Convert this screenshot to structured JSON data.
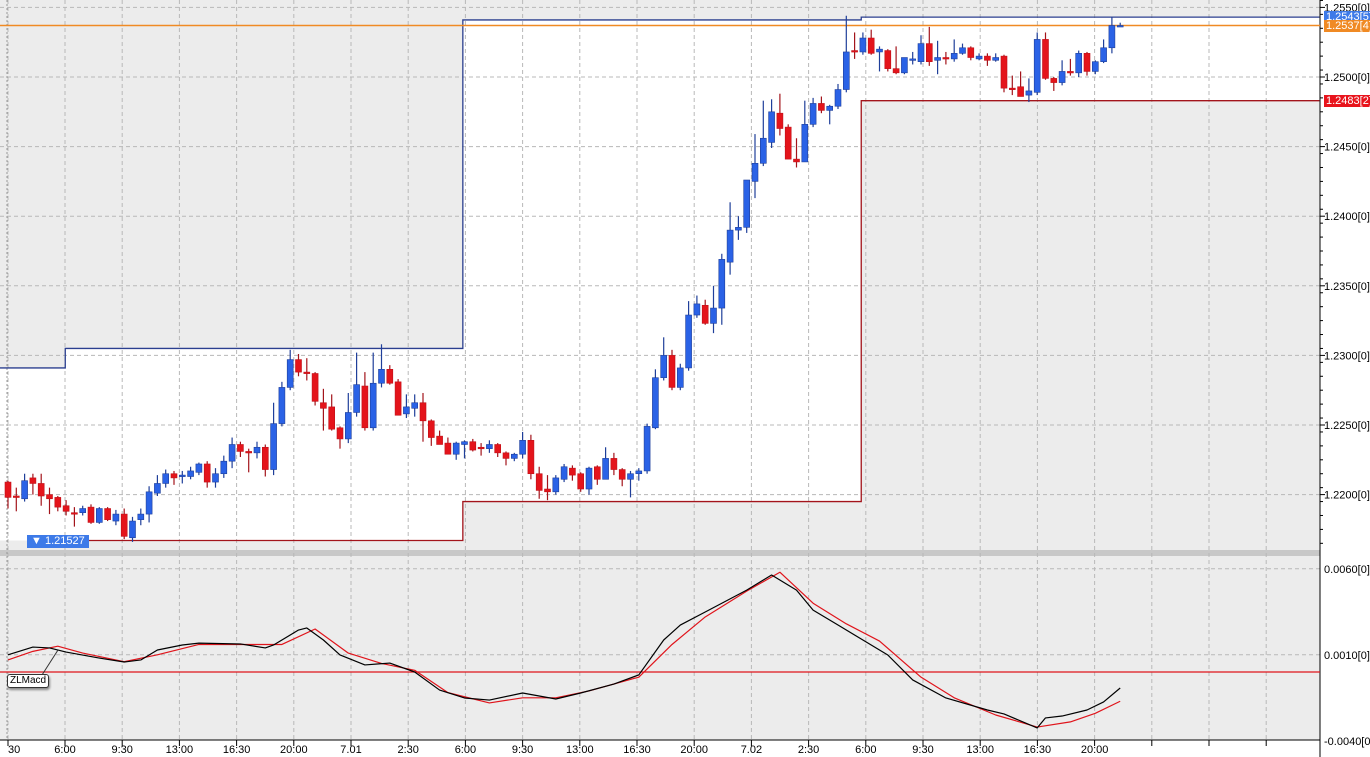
{
  "chart_data": {
    "type": "candlestick",
    "interval": "30min",
    "price_axis": {
      "range": [
        1.2165,
        1.2555
      ],
      "ticks": [
        "1.2550[0]",
        "1.2500[0]",
        "1.2450[0]",
        "1.2400[0]",
        "1.2350[0]",
        "1.2300[0]",
        "1.2250[0]",
        "1.2200[0]"
      ],
      "tick_values": [
        1.255,
        1.25,
        1.245,
        1.24,
        1.235,
        1.23,
        1.225,
        1.22
      ]
    },
    "time_ticks": [
      "30",
      "6:00",
      "9:30",
      "13:00",
      "16:30",
      "20:00",
      "7.01",
      "2:30",
      "6:00",
      "9:30",
      "13:00",
      "16:30",
      "20:00",
      "7.02",
      "2:30",
      "6:00",
      "9:30",
      "13:00",
      "16:30",
      "20:00"
    ],
    "colors": {
      "up": "#2a62e6",
      "down": "#e4141b",
      "upper_channel": "#2b3f8f",
      "lower_channel": "#a3141b",
      "last_price": "#f08a24",
      "macd": "#000000",
      "signal": "#e0141b",
      "shade": "#ececec"
    },
    "candles": [
      [
        1.2209,
        1.221,
        1.219,
        1.2198
      ],
      [
        1.2199,
        1.2205,
        1.2188,
        1.2198
      ],
      [
        1.2197,
        1.2215,
        1.2195,
        1.221
      ],
      [
        1.2212,
        1.2215,
        1.22,
        1.2208
      ],
      [
        1.2208,
        1.2215,
        1.2192,
        1.2199
      ],
      [
        1.22,
        1.2205,
        1.2186,
        1.2197
      ],
      [
        1.2198,
        1.2199,
        1.2188,
        1.2191
      ],
      [
        1.2192,
        1.2196,
        1.2185,
        1.2188
      ],
      [
        1.2187,
        1.2191,
        1.2177,
        1.2186
      ],
      [
        1.2187,
        1.2192,
        1.2185,
        1.219
      ],
      [
        1.2191,
        1.2193,
        1.2179,
        1.218
      ],
      [
        1.218,
        1.2191,
        1.2179,
        1.219
      ],
      [
        1.219,
        1.2191,
        1.2181,
        1.2182
      ],
      [
        1.2181,
        1.2189,
        1.2178,
        1.2186
      ],
      [
        1.2186,
        1.219,
        1.2168,
        1.217
      ],
      [
        1.2169,
        1.2184,
        1.2166,
        1.2181
      ],
      [
        1.2182,
        1.219,
        1.2178,
        1.2186
      ],
      [
        1.2186,
        1.2206,
        1.218,
        1.2202
      ],
      [
        1.2201,
        1.2214,
        1.2199,
        1.2208
      ],
      [
        1.2208,
        1.2218,
        1.2205,
        1.2215
      ],
      [
        1.2215,
        1.2217,
        1.2207,
        1.2212
      ],
      [
        1.2213,
        1.2217,
        1.2208,
        1.2214
      ],
      [
        1.2213,
        1.222,
        1.2211,
        1.2217
      ],
      [
        1.2216,
        1.2223,
        1.2214,
        1.2222
      ],
      [
        1.2222,
        1.2224,
        1.2205,
        1.2209
      ],
      [
        1.2209,
        1.2219,
        1.2205,
        1.2215
      ],
      [
        1.2215,
        1.2228,
        1.2212,
        1.2224
      ],
      [
        1.2224,
        1.2241,
        1.2219,
        1.2236
      ],
      [
        1.2236,
        1.2238,
        1.2227,
        1.2231
      ],
      [
        1.2231,
        1.2233,
        1.2216,
        1.223
      ],
      [
        1.223,
        1.2238,
        1.2226,
        1.2234
      ],
      [
        1.2234,
        1.2236,
        1.2213,
        1.2218
      ],
      [
        1.2218,
        1.2266,
        1.2214,
        1.2251
      ],
      [
        1.2251,
        1.2281,
        1.2249,
        1.2277
      ],
      [
        1.2277,
        1.2304,
        1.2275,
        1.2297
      ],
      [
        1.2297,
        1.2301,
        1.2285,
        1.2288
      ],
      [
        1.2288,
        1.2298,
        1.2282,
        1.2287
      ],
      [
        1.2287,
        1.2288,
        1.2264,
        1.2267
      ],
      [
        1.2266,
        1.2276,
        1.2246,
        1.2262
      ],
      [
        1.2263,
        1.2272,
        1.2246,
        1.2247
      ],
      [
        1.2248,
        1.2249,
        1.2233,
        1.224
      ],
      [
        1.224,
        1.2273,
        1.2237,
        1.2259
      ],
      [
        1.2259,
        1.2302,
        1.2256,
        1.2279
      ],
      [
        1.2278,
        1.2288,
        1.2246,
        1.2248
      ],
      [
        1.2248,
        1.2302,
        1.2246,
        1.228
      ],
      [
        1.228,
        1.2308,
        1.2277,
        1.229
      ],
      [
        1.229,
        1.2293,
        1.2279,
        1.228
      ],
      [
        1.2281,
        1.2283,
        1.2257,
        1.2257
      ],
      [
        1.2258,
        1.2272,
        1.2255,
        1.2263
      ],
      [
        1.2262,
        1.2272,
        1.2256,
        1.2266
      ],
      [
        1.2266,
        1.2273,
        1.2238,
        1.2253
      ],
      [
        1.2253,
        1.2254,
        1.2235,
        1.2241
      ],
      [
        1.2242,
        1.2246,
        1.2236,
        1.2236
      ],
      [
        1.2237,
        1.2241,
        1.2229,
        1.2229
      ],
      [
        1.2229,
        1.2238,
        1.2225,
        1.2237
      ],
      [
        1.2236,
        1.2239,
        1.2226,
        1.2238
      ],
      [
        1.2238,
        1.224,
        1.2231,
        1.2232
      ],
      [
        1.2234,
        1.2237,
        1.2228,
        1.2233
      ],
      [
        1.2233,
        1.2239,
        1.223,
        1.2236
      ],
      [
        1.2236,
        1.2237,
        1.2227,
        1.223
      ],
      [
        1.223,
        1.2231,
        1.2221,
        1.2226
      ],
      [
        1.2226,
        1.223,
        1.2224,
        1.2229
      ],
      [
        1.2229,
        1.2245,
        1.2226,
        1.2239
      ],
      [
        1.2239,
        1.2243,
        1.2211,
        1.2215
      ],
      [
        1.2215,
        1.222,
        1.2197,
        1.2203
      ],
      [
        1.2204,
        1.2214,
        1.2196,
        1.2202
      ],
      [
        1.2202,
        1.2214,
        1.22,
        1.2212
      ],
      [
        1.2211,
        1.2222,
        1.2209,
        1.222
      ],
      [
        1.2219,
        1.2221,
        1.221,
        1.2214
      ],
      [
        1.2215,
        1.2216,
        1.2202,
        1.2204
      ],
      [
        1.2204,
        1.222,
        1.22,
        1.2219
      ],
      [
        1.222,
        1.2221,
        1.2207,
        1.2211
      ],
      [
        1.2211,
        1.2234,
        1.2211,
        1.2226
      ],
      [
        1.2226,
        1.223,
        1.2214,
        1.2218
      ],
      [
        1.2218,
        1.2219,
        1.2206,
        1.2211
      ],
      [
        1.2211,
        1.2217,
        1.2198,
        1.2215
      ],
      [
        1.2215,
        1.2219,
        1.221,
        1.2217
      ],
      [
        1.2217,
        1.2251,
        1.2215,
        1.2249
      ],
      [
        1.2248,
        1.229,
        1.2247,
        1.2284
      ],
      [
        1.2284,
        1.2313,
        1.2282,
        1.23
      ],
      [
        1.23,
        1.2304,
        1.2275,
        1.2277
      ],
      [
        1.2277,
        1.2294,
        1.2275,
        1.2291
      ],
      [
        1.2291,
        1.2339,
        1.2289,
        1.2329
      ],
      [
        1.2329,
        1.2343,
        1.2327,
        1.2337
      ],
      [
        1.2336,
        1.234,
        1.2322,
        1.2323
      ],
      [
        1.2323,
        1.235,
        1.2316,
        1.2334
      ],
      [
        1.2334,
        1.2373,
        1.2322,
        1.2369
      ],
      [
        1.2367,
        1.241,
        1.2358,
        1.239
      ],
      [
        1.239,
        1.24,
        1.2383,
        1.2392
      ],
      [
        1.2392,
        1.2426,
        1.2388,
        1.2426
      ],
      [
        1.2425,
        1.2459,
        1.2413,
        1.2438
      ],
      [
        1.2438,
        1.2483,
        1.2436,
        1.2456
      ],
      [
        1.2453,
        1.2484,
        1.2449,
        1.2475
      ],
      [
        1.2474,
        1.2488,
        1.2458,
        1.2463
      ],
      [
        1.2464,
        1.2466,
        1.2441,
        1.2441
      ],
      [
        1.2441,
        1.2456,
        1.2435,
        1.2439
      ],
      [
        1.2439,
        1.2483,
        1.2439,
        1.2466
      ],
      [
        1.2466,
        1.2485,
        1.2464,
        1.2481
      ],
      [
        1.2481,
        1.2486,
        1.2474,
        1.2476
      ],
      [
        1.2476,
        1.248,
        1.2466,
        1.2479
      ],
      [
        1.2479,
        1.2495,
        1.2477,
        1.2491
      ],
      [
        1.2491,
        1.2544,
        1.2489,
        1.2518
      ],
      [
        1.2519,
        1.2532,
        1.2513,
        1.2518
      ],
      [
        1.2518,
        1.2532,
        1.2516,
        1.2528
      ],
      [
        1.2528,
        1.2534,
        1.2516,
        1.2517
      ],
      [
        1.2518,
        1.2522,
        1.2504,
        1.252
      ],
      [
        1.2519,
        1.252,
        1.2504,
        1.2506
      ],
      [
        1.2506,
        1.2522,
        1.2502,
        1.2503
      ],
      [
        1.2503,
        1.2514,
        1.2502,
        1.2514
      ],
      [
        1.2513,
        1.2518,
        1.2509,
        1.2513
      ],
      [
        1.2511,
        1.253,
        1.2509,
        1.2524
      ],
      [
        1.2524,
        1.2536,
        1.2508,
        1.2511
      ],
      [
        1.2512,
        1.2526,
        1.2502,
        1.2514
      ],
      [
        1.2514,
        1.2518,
        1.2509,
        1.2513
      ],
      [
        1.2513,
        1.2527,
        1.2511,
        1.2517
      ],
      [
        1.2517,
        1.2524,
        1.2516,
        1.2521
      ],
      [
        1.2521,
        1.2522,
        1.2512,
        1.2514
      ],
      [
        1.2513,
        1.2517,
        1.2512,
        1.2515
      ],
      [
        1.2515,
        1.2517,
        1.2508,
        1.2512
      ],
      [
        1.2512,
        1.2517,
        1.2511,
        1.2514
      ],
      [
        1.2515,
        1.2516,
        1.2489,
        1.2492
      ],
      [
        1.2492,
        1.2501,
        1.2487,
        1.2491
      ],
      [
        1.2493,
        1.2504,
        1.2486,
        1.2486
      ],
      [
        1.2487,
        1.2499,
        1.2482,
        1.249
      ],
      [
        1.2489,
        1.2532,
        1.2487,
        1.2527
      ],
      [
        1.2527,
        1.2532,
        1.2498,
        1.2499
      ],
      [
        1.2499,
        1.25,
        1.249,
        1.2496
      ],
      [
        1.2496,
        1.2512,
        1.2494,
        1.2504
      ],
      [
        1.2504,
        1.2513,
        1.2501,
        1.2503
      ],
      [
        1.2503,
        1.2519,
        1.25,
        1.2517
      ],
      [
        1.2517,
        1.2518,
        1.2501,
        1.2504
      ],
      [
        1.2504,
        1.2512,
        1.2502,
        1.2511
      ],
      [
        1.2511,
        1.2527,
        1.251,
        1.2521
      ],
      [
        1.2521,
        1.2543,
        1.2517,
        1.2537
      ],
      [
        1.2537,
        1.2539,
        1.2536,
        1.2537
      ]
    ],
    "upper_channel": [
      {
        "from": -1,
        "to": 6.9,
        "price": 1.2291
      },
      {
        "from": 6.9,
        "to": 54.8,
        "price": 1.2305
      },
      {
        "from": 54.8,
        "to": 102.8,
        "price": 1.2541
      },
      {
        "from": 102.8,
        "to": 158,
        "price": 1.2543
      }
    ],
    "lower_channel": [
      {
        "from": 2.7,
        "to": 54.8,
        "price": 1.2167
      },
      {
        "from": 54.8,
        "to": 102.8,
        "price": 1.2195
      },
      {
        "from": 102.8,
        "to": 158,
        "price": 1.2483
      }
    ],
    "last_price": 1.2537,
    "price_tags": [
      {
        "text": "1.2543[5]",
        "price": 1.2543,
        "color": "#3d7ae8"
      },
      {
        "text": "1.2537[4]",
        "price": 1.2537,
        "color": "#f08a24"
      },
      {
        "text": "1.2483[2]",
        "price": 1.2483,
        "color": "#e8141c"
      }
    ],
    "low_marker": {
      "text": "1.21527"
    },
    "indicator": {
      "name": "ZLMacd",
      "axis_ticks": [
        "0.0060[0]",
        "0.0010[0]",
        "-0.0040[0]"
      ],
      "tick_values": [
        0.006,
        0.001,
        -0.004
      ],
      "zero_line": 0,
      "macd": [
        [
          0,
          0.001
        ],
        [
          3,
          0.00145
        ],
        [
          5,
          0.0014
        ],
        [
          7,
          0.00116
        ],
        [
          11,
          0.00081
        ],
        [
          14,
          0.00058
        ],
        [
          16,
          0.0007
        ],
        [
          18,
          0.00128
        ],
        [
          21,
          0.00157
        ],
        [
          23,
          0.00168
        ],
        [
          28,
          0.00163
        ],
        [
          31,
          0.0014
        ],
        [
          32,
          0.00157
        ],
        [
          35,
          0.00244
        ],
        [
          36,
          0.00256
        ],
        [
          38,
          0.00186
        ],
        [
          40,
          0.00099
        ],
        [
          43,
          0.00041
        ],
        [
          46,
          0.00052
        ],
        [
          49,
          0
        ],
        [
          52,
          -0.00105
        ],
        [
          55,
          -0.00151
        ],
        [
          58,
          -0.00163
        ],
        [
          62,
          -0.00122
        ],
        [
          66,
          -0.00157
        ],
        [
          69,
          -0.00122
        ],
        [
          73,
          -0.0007
        ],
        [
          76,
          -0.00017
        ],
        [
          79,
          0.00186
        ],
        [
          81,
          0.00273
        ],
        [
          84,
          0.00349
        ],
        [
          89,
          0.00476
        ],
        [
          92,
          0.00564
        ],
        [
          95,
          0.00476
        ],
        [
          97,
          0.0036
        ],
        [
          100,
          0.00273
        ],
        [
          103,
          0.00186
        ],
        [
          106,
          0.00099
        ],
        [
          109,
          -0.00046
        ],
        [
          113,
          -0.00151
        ],
        [
          118,
          -0.00221
        ],
        [
          120,
          -0.00244
        ],
        [
          124,
          -0.00325
        ],
        [
          125,
          -0.00267
        ],
        [
          127,
          -0.00256
        ],
        [
          130,
          -0.00221
        ],
        [
          132,
          -0.00174
        ],
        [
          134,
          -0.00093
        ]
      ],
      "signal": [
        [
          0,
          0.0007
        ],
        [
          3,
          0.0012
        ],
        [
          6,
          0.0015
        ],
        [
          9,
          0.0011
        ],
        [
          14,
          0.0006
        ],
        [
          18,
          0.001
        ],
        [
          23,
          0.0016
        ],
        [
          29,
          0.0016
        ],
        [
          33,
          0.0016
        ],
        [
          37,
          0.0025
        ],
        [
          41,
          0.0011
        ],
        [
          45,
          0.0005
        ],
        [
          49,
          0.0001
        ],
        [
          53,
          -0.0012
        ],
        [
          58,
          -0.0018
        ],
        [
          62,
          -0.0015
        ],
        [
          66,
          -0.0015
        ],
        [
          70,
          -0.0011
        ],
        [
          76,
          -0.0003
        ],
        [
          80,
          0.0016
        ],
        [
          84,
          0.0032
        ],
        [
          89,
          0.0047
        ],
        [
          93,
          0.0058
        ],
        [
          97,
          0.004
        ],
        [
          101,
          0.0028
        ],
        [
          105,
          0.0018
        ],
        [
          110,
          -0.0003
        ],
        [
          114,
          -0.0015
        ],
        [
          119,
          -0.0025
        ],
        [
          124,
          -0.0032
        ],
        [
          128,
          -0.0029
        ],
        [
          131,
          -0.0024
        ],
        [
          134,
          -0.0017
        ]
      ]
    }
  }
}
